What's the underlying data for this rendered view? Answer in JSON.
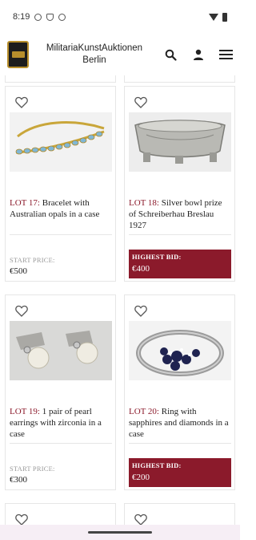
{
  "status_bar": {
    "time": "8:19",
    "left_icons": [
      "settings-icon",
      "shield-icon",
      "settings-icon"
    ],
    "right_icons": [
      "wifi-icon",
      "battery-icon"
    ]
  },
  "header": {
    "brand_line1": "MilitariaKunstAuktionen",
    "brand_line2": "Berlin",
    "icons": [
      "search-icon",
      "user-icon",
      "hamburger-menu-icon"
    ]
  },
  "lots": [
    {
      "lot_label": "LOT 17:",
      "title": "Bracelet with Australian opals in a case",
      "price_label": "START PRICE:",
      "price": "€500",
      "highlighted": false
    },
    {
      "lot_label": "LOT 18:",
      "title": "Silver bowl prize of Schreiberhau Breslau 1927",
      "price_label": "HIGHEST BID:",
      "price": "€400",
      "highlighted": true
    },
    {
      "lot_label": "LOT 19:",
      "title": "1 pair of pearl earrings with zirconia in a case",
      "price_label": "START PRICE:",
      "price": "€300",
      "highlighted": false
    },
    {
      "lot_label": "LOT 20:",
      "title": "Ring with sapphires and diamonds in a case",
      "price_label": "HIGHEST BID:",
      "price": "€200",
      "highlighted": true
    }
  ],
  "colors": {
    "accent": "#8b1a2b",
    "border": "#e6e6e6",
    "muted_text": "#999999"
  }
}
